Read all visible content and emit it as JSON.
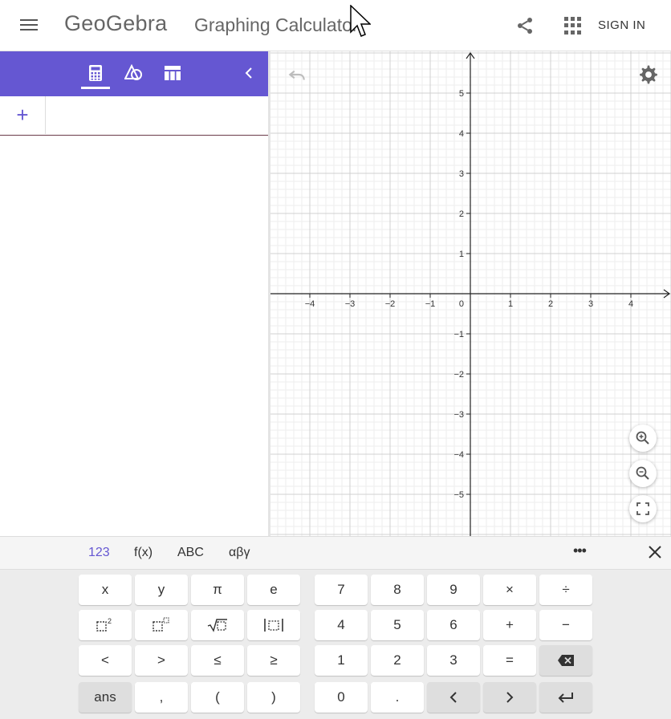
{
  "header": {
    "logo": "GeoGebra",
    "title": "Graphing Calculator",
    "sign_in": "SIGN IN"
  },
  "icons": {
    "menu": "hamburger-menu-icon",
    "share": "share-icon",
    "apps": "apps-grid-icon",
    "algebra": "calculator-icon",
    "tools": "shapes-icon",
    "table": "table-icon",
    "collapse": "chevron-left-icon",
    "undo": "undo-icon",
    "settings": "gear-icon",
    "zoom_in": "zoom-in-icon",
    "zoom_out": "zoom-out-icon",
    "fullscreen": "fullscreen-icon"
  },
  "colors": {
    "accent": "#6557d2",
    "grid_minor": "#eeeeee",
    "grid_major": "#d0d0d0",
    "axis": "#222222"
  },
  "algebra": {
    "add_label": "+"
  },
  "graph": {
    "x_ticks": [
      "−4",
      "−3",
      "−2",
      "−1",
      "1",
      "2",
      "3",
      "4"
    ],
    "y_ticks": [
      "5",
      "4",
      "3",
      "2",
      "1",
      "−1",
      "−2",
      "−3",
      "−4",
      "−5"
    ],
    "origin_label": "0",
    "x_range": [
      -5,
      5
    ],
    "y_range": [
      -6,
      6
    ]
  },
  "keyboard": {
    "tabs": [
      "123",
      "f(x)",
      "ABC",
      "αβγ"
    ],
    "active_tab": "123",
    "more": "•••",
    "rows": [
      [
        "x",
        "y",
        "π",
        "e",
        "7",
        "8",
        "9",
        "×",
        "÷"
      ],
      [
        "x²",
        "xⁿ",
        "√x",
        "|x|",
        "4",
        "5",
        "6",
        "+",
        "−"
      ],
      [
        "<",
        ">",
        "≤",
        "≥",
        "1",
        "2",
        "3",
        "=",
        "backspace"
      ],
      [
        "ans",
        ",",
        "(",
        ")",
        "0",
        ".",
        "left",
        "right",
        "enter"
      ]
    ]
  }
}
